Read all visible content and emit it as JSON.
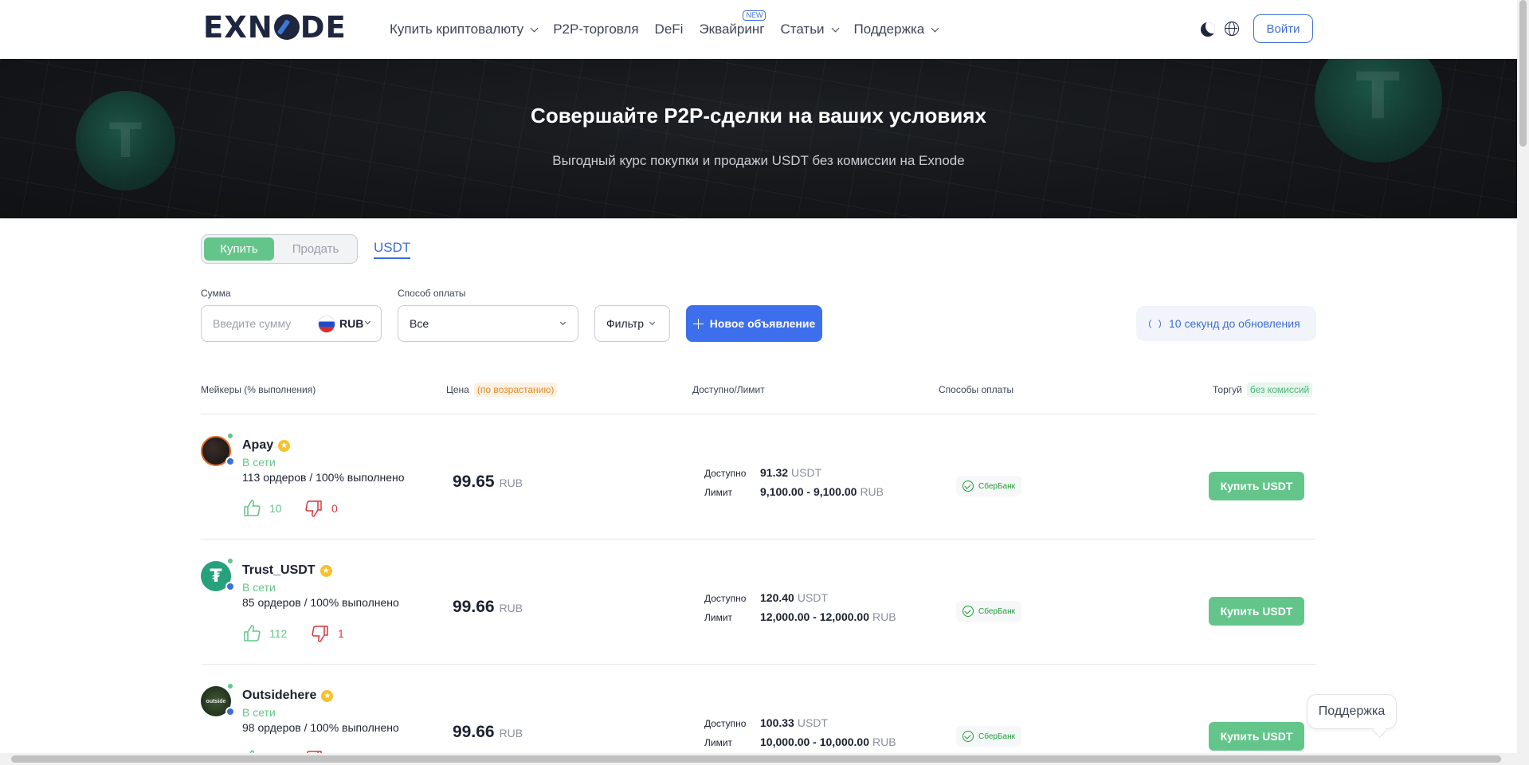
{
  "header": {
    "logo": [
      "EXN",
      "DE"
    ],
    "nav": [
      {
        "label": "Купить криптовалюту",
        "dropdown": true
      },
      {
        "label": "P2P-торговля",
        "dropdown": false
      },
      {
        "label": "DeFi",
        "dropdown": false
      },
      {
        "label": "Эквайринг",
        "dropdown": false,
        "badge": "NEW"
      },
      {
        "label": "Статьи",
        "dropdown": true
      },
      {
        "label": "Поддержка",
        "dropdown": true
      }
    ],
    "login_label": "Войти"
  },
  "hero": {
    "title": "Совершайте P2P-сделки на ваших условиях",
    "subtitle": "Выгодный курс покупки и продажи USDT без комиссии на Exnode"
  },
  "controls": {
    "buy_label": "Купить",
    "sell_label": "Продать",
    "coin_tab": "USDT",
    "amount_label": "Сумма",
    "amount_placeholder": "Введите сумму",
    "currency": "RUB",
    "payment_label": "Способ оплаты",
    "payment_value": "Все",
    "filter_label": "Фильтр",
    "new_ad_label": "Новое объявление",
    "refresh_text": "10 секунд до обновления"
  },
  "table": {
    "col_makers": "Мейкеры (% выполнения)",
    "col_price": "Цена",
    "col_price_sort": "(по возрастанию)",
    "col_available": "Доступно/Лимит",
    "col_payment": "Способы оплаты",
    "col_trade": "Торгуй",
    "col_trade_tag": "без комиссий",
    "available_key": "Доступно",
    "limit_key": "Лимит",
    "rows": [
      {
        "name": "Apay",
        "status": "В сети",
        "orders": "113 ордеров / 100% выполнено",
        "likes": "10",
        "dislikes": "0",
        "price": "99.65",
        "price_currency": "RUB",
        "available": "91.32",
        "available_unit": "USDT",
        "limit": "9,100.00 - 9,100.00",
        "limit_unit": "RUB",
        "bank": "СберБанк",
        "button": "Купить USDT"
      },
      {
        "name": "Trust_USDT",
        "status": "В сети",
        "orders": "85 ордеров / 100% выполнено",
        "likes": "112",
        "dislikes": "1",
        "price": "99.66",
        "price_currency": "RUB",
        "available": "120.40",
        "available_unit": "USDT",
        "limit": "12,000.00 - 12,000.00",
        "limit_unit": "RUB",
        "bank": "СберБанк",
        "button": "Купить USDT"
      },
      {
        "name": "Outsidehere",
        "status": "В сети",
        "orders": "98 ордеров / 100% выполнено",
        "likes": "",
        "dislikes": "",
        "price": "99.66",
        "price_currency": "RUB",
        "available": "100.33",
        "available_unit": "USDT",
        "limit": "10,000.00 - 10,000.00",
        "limit_unit": "RUB",
        "bank": "СберБанк",
        "button": "Купить USDT",
        "avatar_text": "outside"
      }
    ]
  },
  "support_label": "Поддержка",
  "colors": {
    "accent_blue": "#3d6fec",
    "accent_green": "#63c58a",
    "dislike_red": "#d33a3a"
  }
}
